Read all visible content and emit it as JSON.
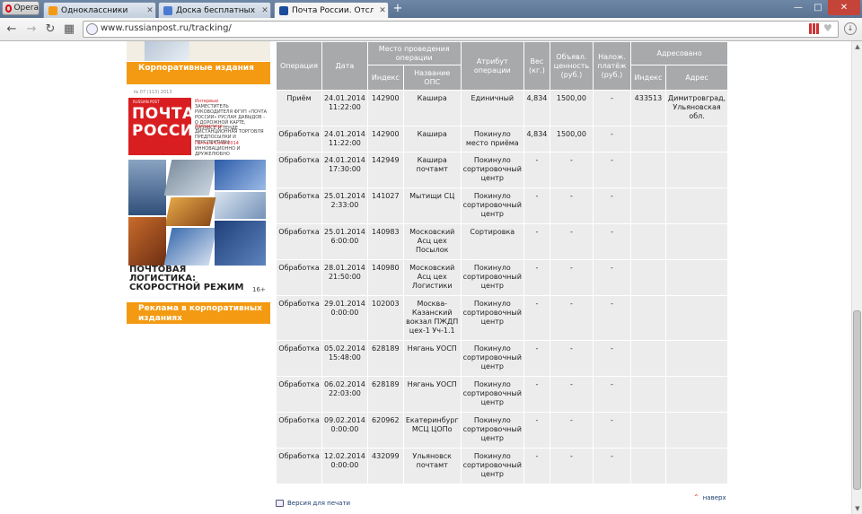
{
  "browser": {
    "menu_label": "Opera",
    "tabs": [
      {
        "label": "Одноклассники",
        "color": "#f39a12"
      },
      {
        "label": "Доска бесплатных объявле",
        "color": "#4a7bd1"
      },
      {
        "label": "Почта России. Отслежива",
        "color": "#1c4c9c"
      }
    ],
    "new_tab": "+",
    "url": "www.russianpost.ru/tracking/"
  },
  "sidebar": {
    "corp_label": "Корпоративные издания",
    "ads_label": "Реклама в корпоративных изданиях",
    "magazine": {
      "issue": "№ 07 (113) 2013",
      "small": "RUSSIAN POST",
      "title": "ПОЧТА РОССИИ",
      "teasers": [
        {
          "head": "Интервью",
          "body": "ЗАМЕСТИТЕЛЬ РУКОВОДИТЕЛЯ ФГУП «ПОЧТА РОССИИ» РУСЛАН ДАВЫДОВ – О ДОРОЖНОЙ КАРТЕ, БИЗНЕСЕ И ТЕНДЕ"
        },
        {
          "head": "Экспертиза",
          "body": "ДИСТАНЦИОННАЯ ТОРГОВЛЯ ПРЕДПОСЫЛКИ И ПЕРСПЕКТИВЫ"
        },
        {
          "head": "Почта в Сочи 2014",
          "body": "ИННОВАЦИОННО И ДРУЖЕЛЮБНО"
        }
      ],
      "bottom": "ПОЧТОВАЯ ЛОГИСТИКА: СКОРОСТНОЙ РЕЖИМ",
      "age": "16+"
    }
  },
  "table": {
    "headers": {
      "operation": "Операция",
      "date": "Дата",
      "place": "Место проведения операции",
      "index": "Индекс",
      "ops_name": "Название ОПС",
      "attribute": "Атрибут операции",
      "weight": "Вес (кг.)",
      "declared": "Объявл. ценность (руб.)",
      "cod": "Налож. платёж (руб.)",
      "addressed": "Адресовано",
      "addr_index": "Индекс",
      "address": "Адрес"
    },
    "rows": [
      {
        "op": "Приём",
        "date": "24.01.2014 11:22:00",
        "idx": "142900",
        "name": "Кашира",
        "attr": "Единичный",
        "weight": "4,834",
        "value": "1500,00",
        "cod": "-",
        "aidx": "433513",
        "addr": "Димитровград, Ульяновская обл."
      },
      {
        "op": "Обработка",
        "date": "24.01.2014 11:22:00",
        "idx": "142900",
        "name": "Кашира",
        "attr": "Покинуло место приёма",
        "weight": "4,834",
        "value": "1500,00",
        "cod": "-",
        "aidx": "",
        "addr": ""
      },
      {
        "op": "Обработка",
        "date": "24.01.2014 17:30:00",
        "idx": "142949",
        "name": "Кашира почтамт",
        "attr": "Покинуло сортировочный центр",
        "weight": "-",
        "value": "-",
        "cod": "-",
        "aidx": "",
        "addr": ""
      },
      {
        "op": "Обработка",
        "date": "25.01.2014 2:33:00",
        "idx": "141027",
        "name": "Мытищи СЦ",
        "attr": "Покинуло сортировочный центр",
        "weight": "-",
        "value": "-",
        "cod": "-",
        "aidx": "",
        "addr": ""
      },
      {
        "op": "Обработка",
        "date": "25.01.2014 6:00:00",
        "idx": "140983",
        "name": "Московский Асц цех Посылок",
        "attr": "Сортировка",
        "weight": "-",
        "value": "-",
        "cod": "-",
        "aidx": "",
        "addr": ""
      },
      {
        "op": "Обработка",
        "date": "28.01.2014 21:50:00",
        "idx": "140980",
        "name": "Московский Асц цех Логистики",
        "attr": "Покинуло сортировочный центр",
        "weight": "-",
        "value": "-",
        "cod": "-",
        "aidx": "",
        "addr": ""
      },
      {
        "op": "Обработка",
        "date": "29.01.2014 0:00:00",
        "idx": "102003",
        "name": "Москва-Казанский вокзал ПЖДП цех-1 Уч-1.1",
        "attr": "Покинуло сортировочный центр",
        "weight": "-",
        "value": "-",
        "cod": "-",
        "aidx": "",
        "addr": ""
      },
      {
        "op": "Обработка",
        "date": "05.02.2014 15:48:00",
        "idx": "628189",
        "name": "Нягань УОСП",
        "attr": "Покинуло сортировочный центр",
        "weight": "-",
        "value": "-",
        "cod": "-",
        "aidx": "",
        "addr": ""
      },
      {
        "op": "Обработка",
        "date": "06.02.2014 22:03:00",
        "idx": "628189",
        "name": "Нягань УОСП",
        "attr": "Покинуло сортировочный центр",
        "weight": "-",
        "value": "-",
        "cod": "-",
        "aidx": "",
        "addr": ""
      },
      {
        "op": "Обработка",
        "date": "09.02.2014 0:00:00",
        "idx": "620962",
        "name": "Екатеринбург МСЦ ЦОПо",
        "attr": "Покинуло сортировочный центр",
        "weight": "-",
        "value": "-",
        "cod": "-",
        "aidx": "",
        "addr": ""
      },
      {
        "op": "Обработка",
        "date": "12.02.2014 0:00:00",
        "idx": "432099",
        "name": "Ульяновск почтамт",
        "attr": "Покинуло сортировочный центр",
        "weight": "-",
        "value": "-",
        "cod": "-",
        "aidx": "",
        "addr": ""
      }
    ]
  },
  "footer": {
    "print_label": "Версия для печати",
    "up_label": "наверх"
  }
}
